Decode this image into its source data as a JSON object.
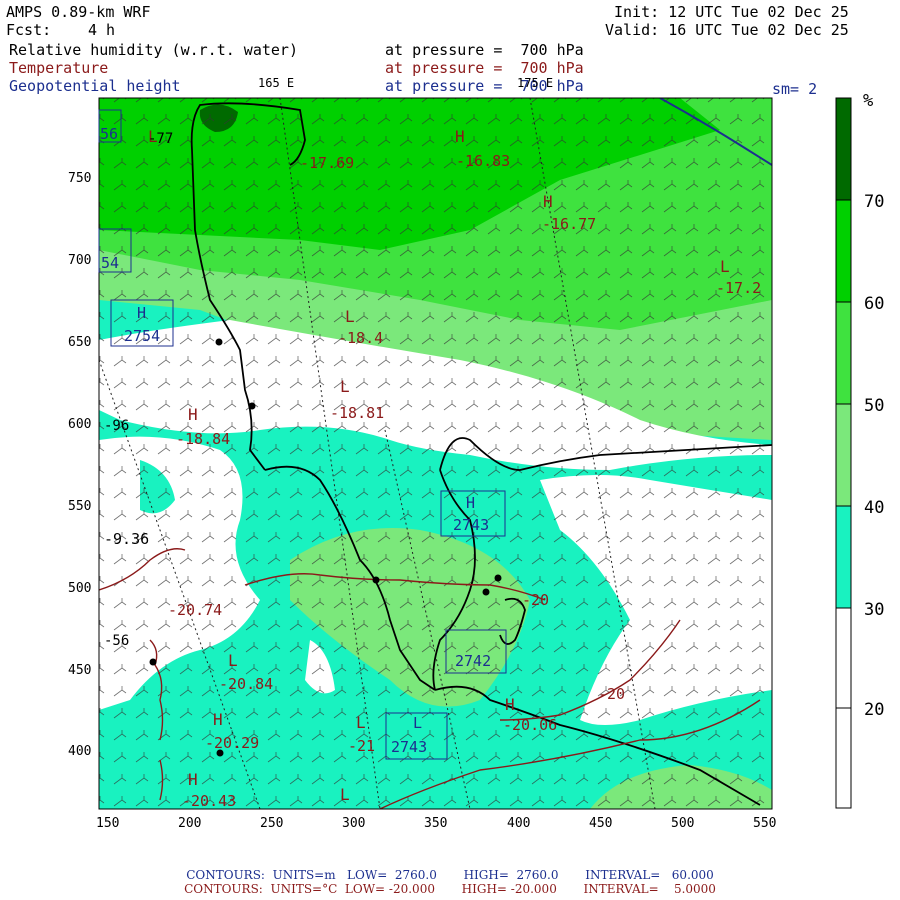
{
  "header": {
    "model": "AMPS 0.89-km WRF",
    "init": "Init: 12 UTC Tue 02 Dec 25",
    "fcst_label": "Fcst:",
    "fcst_value": "4 h",
    "valid": "Valid: 16 UTC Tue 02 Dec 25",
    "fields": [
      {
        "name": "Relative humidity (w.r.t. water)",
        "level": "at pressure =  700 hPa",
        "color": "#000000"
      },
      {
        "name": "Temperature",
        "level": "at pressure =  700 hPa",
        "color": "#8b1a1a"
      },
      {
        "name": "Geopotential height",
        "level": "at pressure =  700 hPa",
        "color": "#1c2f8f"
      }
    ],
    "smoothing": "sm= 2",
    "lon_labels": [
      "165 E",
      "175 E"
    ]
  },
  "axes": {
    "x_ticks": [
      "150",
      "200",
      "250",
      "300",
      "350",
      "400",
      "450",
      "500",
      "550"
    ],
    "y_ticks": [
      "750",
      "700",
      "650",
      "600",
      "550",
      "500",
      "450",
      "400"
    ]
  },
  "colorbar": {
    "unit": "%",
    "labels": [
      "70",
      "60",
      "50",
      "40",
      "30",
      "20"
    ],
    "colors": [
      "#006a00",
      "#00d000",
      "#3fe23f",
      "#7be87b",
      "#19f2c0",
      "#ffffff"
    ]
  },
  "map_labels": {
    "temperature": [
      "-17.69",
      "-16.83",
      "-16.77",
      "-17.2",
      "-18.4",
      "-18.81",
      "-18.84",
      "-20.74",
      "-20.84",
      "-20.29",
      "-20.43",
      "-21",
      "-20.06",
      "-20",
      "-20",
      "-9.36"
    ],
    "highs_lows": [
      "H",
      "H",
      "L",
      "L",
      "L",
      "H",
      "L",
      "H",
      "H",
      "L",
      "H",
      "L",
      "L",
      "H",
      "H",
      "L",
      "L"
    ],
    "height_boxes": [
      "2754",
      "2743",
      "2742",
      "2743",
      "54",
      "56"
    ],
    "contour_fragments": [
      "-77",
      "-96",
      "-56"
    ]
  },
  "footer": {
    "line1": "CONTOURS:  UNITS=m   LOW=  2760.0       HIGH=  2760.0       INTERVAL=   60.000",
    "line2": "CONTOURS:  UNITS=°C  LOW= -20.000       HIGH= -20.000       INTERVAL=    5.0000"
  }
}
